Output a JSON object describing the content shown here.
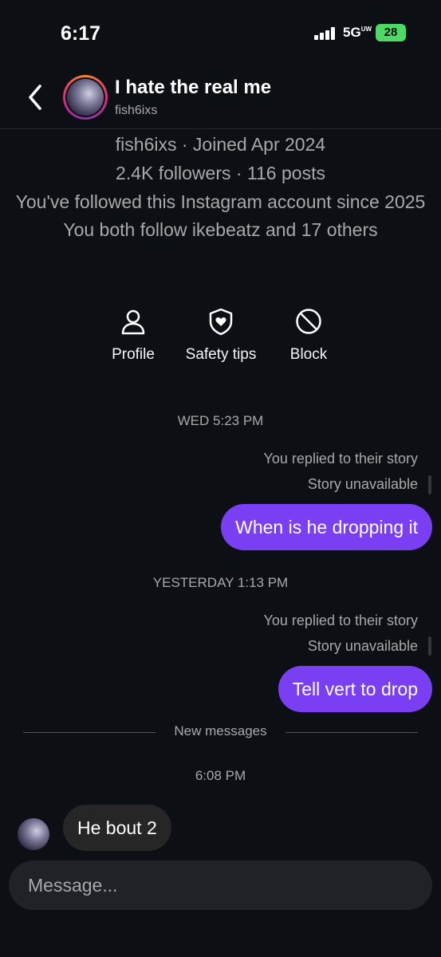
{
  "status_bar": {
    "time": "6:17",
    "network": "5G",
    "network_sub": "UW",
    "battery": "28"
  },
  "header": {
    "title": "I hate the real me",
    "username": "fish6ixs"
  },
  "profile_info": {
    "line1": "fish6ixs · Joined Apr 2024",
    "line2": "2.4K followers · 116 posts",
    "line3": "You've followed this Instagram account since 2025",
    "line4": "You both follow ikebeatz and 17 others"
  },
  "actions": [
    {
      "label": "Profile",
      "icon": "person-icon"
    },
    {
      "label": "Safety tips",
      "icon": "shield-heart-icon"
    },
    {
      "label": "Block",
      "icon": "block-icon"
    }
  ],
  "messages": {
    "ts1": "WED 5:23 PM",
    "reply1": "You replied to their story",
    "unavailable1": "Story unavailable",
    "msg1": "When is he dropping it",
    "ts2": "YESTERDAY 1:13 PM",
    "reply2": "You replied to their story",
    "unavailable2": "Story unavailable",
    "msg2": "Tell vert to drop",
    "new_label": "New messages",
    "ts3": "6:08 PM",
    "msg3": "He bout 2"
  },
  "composer": {
    "placeholder": "Message..."
  },
  "colors": {
    "background": "#0c1014",
    "outgoing_bubble": "#7a3ff2",
    "incoming_bubble": "#262626",
    "battery": "#4cd964"
  }
}
